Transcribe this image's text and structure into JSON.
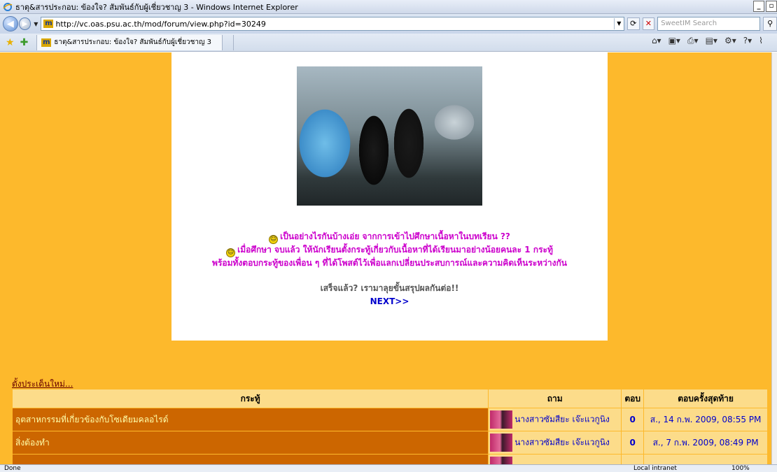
{
  "window": {
    "title": "ธาตุ&สารประกอบ: ข้องใจ? สัมพันธ์กับผู้เชี่ยวชาญ 3 - Windows Internet Explorer",
    "minimize": "_",
    "maximize": "▫"
  },
  "address": {
    "url": "http://vc.oas.psu.ac.th/mod/forum/view.php?id=30249",
    "favicon_text": "m"
  },
  "search": {
    "placeholder": "SweetIM Search"
  },
  "tab": {
    "label": "ธาตุ&สารประกอบ: ข้องใจ? สัมพันธ์กับผู้เชี่ยวชาญ 3",
    "favicon_text": "m"
  },
  "post": {
    "line1": "เป็นอย่างไรกันบ้างเอ่ย จากการเข้าไปศึกษาเนื้อหาในบทเรียน ??",
    "line2": "เมื่อศึกษา จบแล้ว ให้นักเรียนตั้งกระทู้เกี่ยวกับเนื้อหาที่ได้เรียนมาอย่างน้อยคนละ 1 กระทู้",
    "line3": "พร้อมทั้งตอบกระทู้ของเพื่อน ๆ ที่ได้โพสต์ไว้เพื่อแลกเปลี่ยนประสบการณ์และความคิดเห็นระหว่างกัน",
    "done": "เสร็จแล้ว? เรามาลุยขั้นสรุปผลกันต่อ!!",
    "next": "NEXT>>"
  },
  "forum": {
    "new_topic": "ตั้งประเด็นใหม่...",
    "headers": {
      "topic": "กระทู้",
      "author": "ถาม",
      "replies": "ตอบ",
      "last_post": "ตอบครั้งสุดท้าย"
    },
    "rows": [
      {
        "topic": "อุตสาหกรรมที่เกี่ยวข้องกับโซเดียมคลอไรด์",
        "author": "นางสาวซัมสียะ เจ๊ะแวกูนิง",
        "replies": "0",
        "last_post": "ส., 14 ก.พ. 2009, 08:55 PM"
      },
      {
        "topic": "สิ่งต้องทำ",
        "author": "นางสาวซัมสียะ เจ๊ะแวกูนิง",
        "replies": "0",
        "last_post": "ส., 7 ก.พ. 2009, 08:49 PM"
      }
    ]
  },
  "statusbar": {
    "status": "Done",
    "zone": "Local intranet",
    "zoom": "100%"
  }
}
